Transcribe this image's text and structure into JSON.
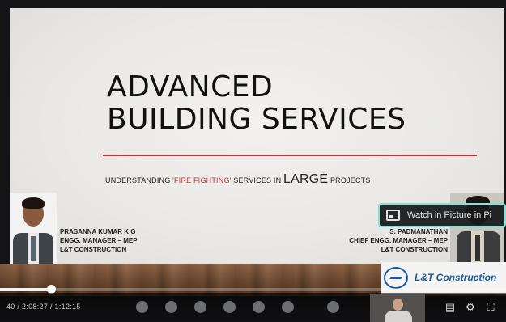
{
  "slide": {
    "title_line1": "ADVANCED",
    "title_line2": "BUILDING SERVICES",
    "subtitle_pre": "UNDERSTANDING ",
    "subtitle_red": "'FIRE FIGHTING'",
    "subtitle_mid": " SERVICES IN ",
    "subtitle_big": "LARGE",
    "subtitle_post": " PROJECTS",
    "presenter_left": {
      "name": "PRASANNA KUMAR K G",
      "role": "ENGG. MANAGER – MEP",
      "org": "L&T CONSTRUCTION"
    },
    "presenter_right": {
      "name": "S. PADMANATHAN",
      "role": "CHIEF ENGG. MANAGER – MEP",
      "org": "L&T CONSTRUCTION"
    },
    "logo_text": "L&T Construction",
    "accent_color": "#c3343a"
  },
  "overlay": {
    "pip_label": "Watch in Picture in Pi"
  },
  "player": {
    "time_display": "40 / 2:08:27 / 1:12:15",
    "progress_fraction": 0.1
  },
  "icons": [
    "pip-icon",
    "logo-icon",
    "captions-icon",
    "settings-icon",
    "fullscreen-icon"
  ]
}
